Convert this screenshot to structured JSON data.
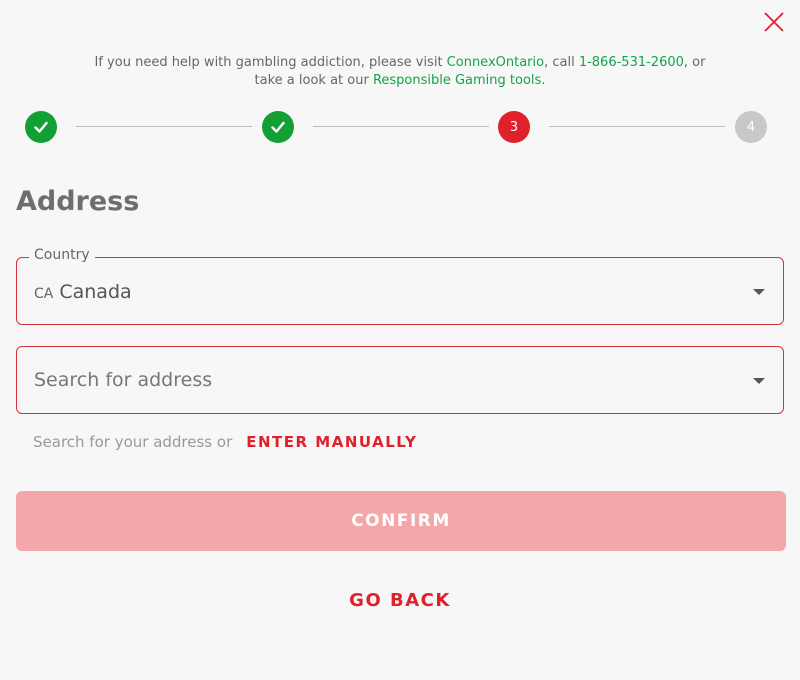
{
  "close": {
    "icon": "close-icon"
  },
  "notice": {
    "part1": "If you need help with gambling addiction, please visit ",
    "link1": "ConnexOntario",
    "part2": ", call ",
    "link2": "1-866-531-2600",
    "part3": ", or take a look at our ",
    "link3": "Responsible Gaming tools",
    "part4": "."
  },
  "stepper": {
    "steps": [
      {
        "status": "done",
        "icon": "check-icon"
      },
      {
        "status": "done",
        "icon": "check-icon"
      },
      {
        "status": "active",
        "label": "3"
      },
      {
        "status": "pending",
        "label": "4"
      }
    ]
  },
  "section": {
    "title": "Address"
  },
  "country": {
    "label": "Country",
    "code": "CA",
    "value": "Canada"
  },
  "address": {
    "placeholder": "Search for address",
    "value": ""
  },
  "hint": {
    "text": "Search for your address or",
    "manual": "ENTER MANUALLY"
  },
  "actions": {
    "confirm": "CONFIRM",
    "go_back": "GO BACK"
  },
  "colors": {
    "accent": "#e0202a",
    "success": "#12a034",
    "link": "#14a34a",
    "pending": "#c8c8c8",
    "confirm_disabled": "#f4a7a8"
  }
}
